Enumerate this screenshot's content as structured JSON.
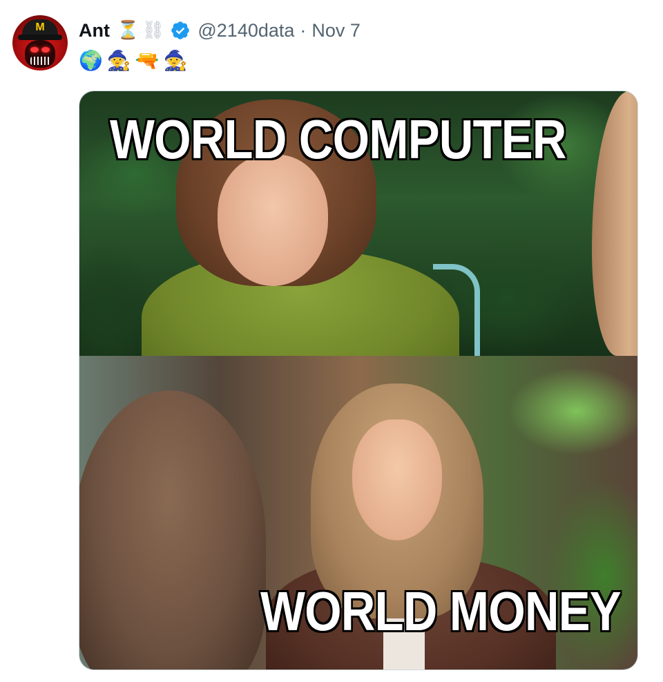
{
  "author": {
    "display_name": "Ant",
    "name_emojis": [
      "⏳",
      "⛓"
    ],
    "handle": "@2140data",
    "separator": "·",
    "date": "Nov 7",
    "verified": true,
    "bio_emojis": [
      "🌍",
      "🧙",
      "🔫",
      "🧙"
    ],
    "avatar_icon": "red-robot-mcdonalds-cap-avatar"
  },
  "media": {
    "top_caption": "WORLD COMPUTER",
    "bottom_caption": "WORLD MONEY"
  },
  "colors": {
    "text_primary": "#0f1419",
    "text_secondary": "#536471",
    "verified_blue": "#1d9bf0",
    "media_border": "#cfd9de"
  }
}
